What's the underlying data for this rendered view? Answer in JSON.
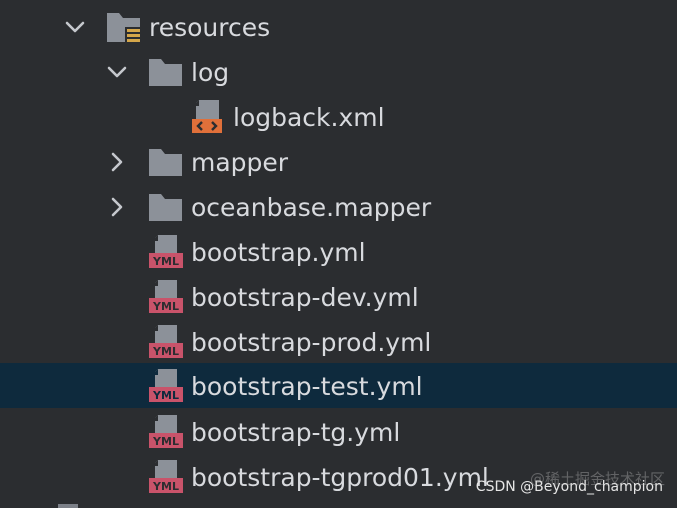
{
  "tree": {
    "items": [
      {
        "label": "resources",
        "type": "resources-folder",
        "expanded": true,
        "indent": 0
      },
      {
        "label": "log",
        "type": "folder",
        "expanded": true,
        "indent": 1
      },
      {
        "label": "logback.xml",
        "type": "xml-file",
        "indent": 2
      },
      {
        "label": "mapper",
        "type": "folder",
        "expanded": false,
        "indent": 1
      },
      {
        "label": "oceanbase.mapper",
        "type": "folder",
        "expanded": false,
        "indent": 1
      },
      {
        "label": "bootstrap.yml",
        "type": "yml-file",
        "indent": 1
      },
      {
        "label": "bootstrap-dev.yml",
        "type": "yml-file",
        "indent": 1
      },
      {
        "label": "bootstrap-prod.yml",
        "type": "yml-file",
        "indent": 1
      },
      {
        "label": "bootstrap-test.yml",
        "type": "yml-file",
        "indent": 1,
        "selected": true
      },
      {
        "label": "bootstrap-tg.yml",
        "type": "yml-file",
        "indent": 1
      },
      {
        "label": "bootstrap-tgprod01.yml",
        "type": "yml-file",
        "indent": 1
      }
    ]
  },
  "icons": {
    "folder": "folder-icon",
    "resources-folder": "resources-folder-icon",
    "xml-file": "xml-file-icon",
    "yml-file": "yml-file-icon",
    "expanded": "chevron-down-icon",
    "collapsed": "chevron-right-icon",
    "yml_badge": "YML"
  },
  "colors": {
    "background": "#2b2d30",
    "selected_row": "#0e2a3d",
    "text": "#d8dade",
    "folder": "#8c9199",
    "xml_accent": "#e0703a",
    "yml_accent": "#c9536a",
    "resources_accent": "#d4a64a"
  },
  "watermark": {
    "text": "CSDN @Beyond_champion",
    "ghost": "@稀土掘金技术社区"
  }
}
